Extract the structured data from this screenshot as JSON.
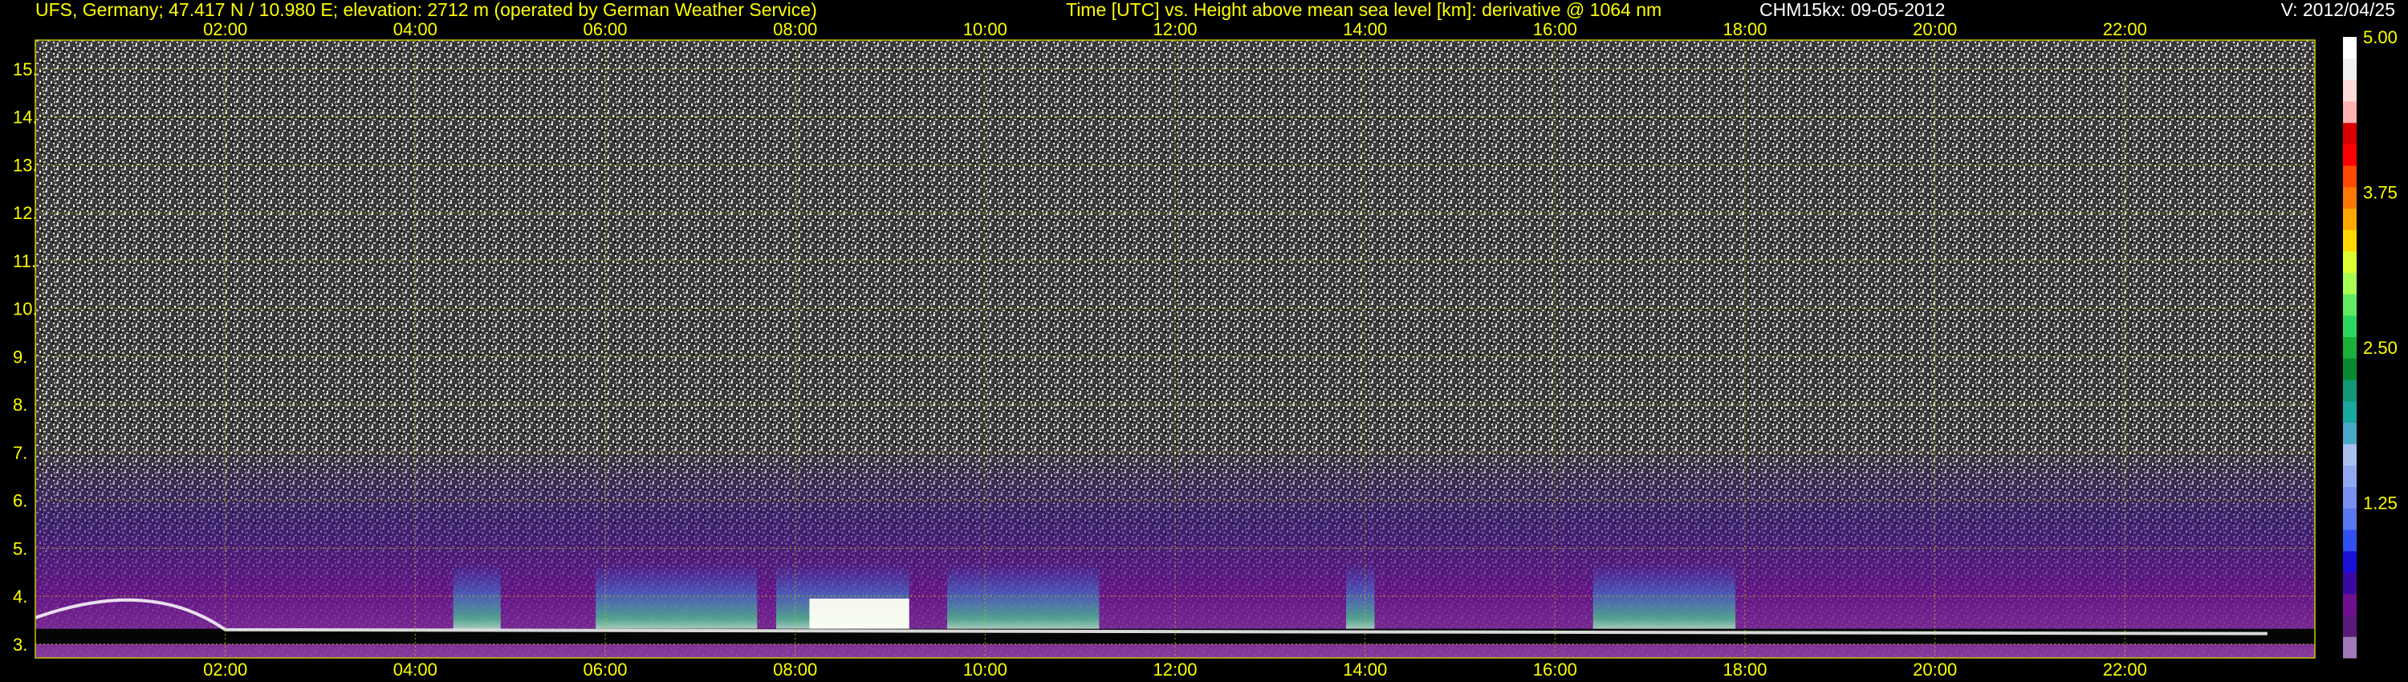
{
  "header": {
    "site_text": "UFS, Germany; 47.417 N / 10.980 E; elevation: 2712 m  (operated by German Weather Service)",
    "title_text": "Time [UTC] vs. Height above mean sea level [km]: derivative @ 1064 nm",
    "instrument_date": "CHM15kx: 09-05-2012",
    "version": "V: 2012/04/25"
  },
  "colors": {
    "background": "#000000",
    "text": "#ffff00",
    "grid": "#c8c800",
    "plot_border": "#c8c800"
  },
  "chart_data": {
    "type": "heatmap",
    "x_ticks": [
      "02:00",
      "04:00",
      "06:00",
      "08:00",
      "10:00",
      "12:00",
      "14:00",
      "16:00",
      "18:00",
      "20:00",
      "22:00"
    ],
    "x_tick_hours": [
      2,
      4,
      6,
      8,
      10,
      12,
      14,
      16,
      18,
      20,
      22
    ],
    "xlim_hours": [
      0,
      24
    ],
    "y_ticks": [
      "3.",
      "4.",
      "5.",
      "6.",
      "7.",
      "8.",
      "9.",
      "10.",
      "11.",
      "12.",
      "13.",
      "14.",
      "15."
    ],
    "y_tick_values": [
      3,
      4,
      5,
      6,
      7,
      8,
      9,
      10,
      11,
      12,
      13,
      14,
      15
    ],
    "ylim_km": [
      2.712,
      15.6
    ],
    "grid": true,
    "colorbar": {
      "tick_labels": [
        "5.00",
        "3.75",
        "2.50",
        "1.25"
      ],
      "tick_values": [
        5.0,
        3.75,
        2.5,
        1.25
      ],
      "range": [
        0,
        5
      ],
      "colors": [
        "#a07ab8",
        "#5a1a78",
        "#6e1090",
        "#3a0aa0",
        "#1a10d8",
        "#3050f0",
        "#5a78f0",
        "#7890f0",
        "#90a8f0",
        "#a8c0f0",
        "#4aa8c8",
        "#1aa8a0",
        "#129878",
        "#0a8a30",
        "#1ab03a",
        "#2ad860",
        "#60ea60",
        "#a8ff50",
        "#ddff30",
        "#ffd800",
        "#ffa800",
        "#ff7800",
        "#ff4800",
        "#ff0000",
        "#d80000",
        "#ffb0b0",
        "#ffd8d8",
        "#f0f0f0",
        "#ffffff"
      ]
    }
  }
}
